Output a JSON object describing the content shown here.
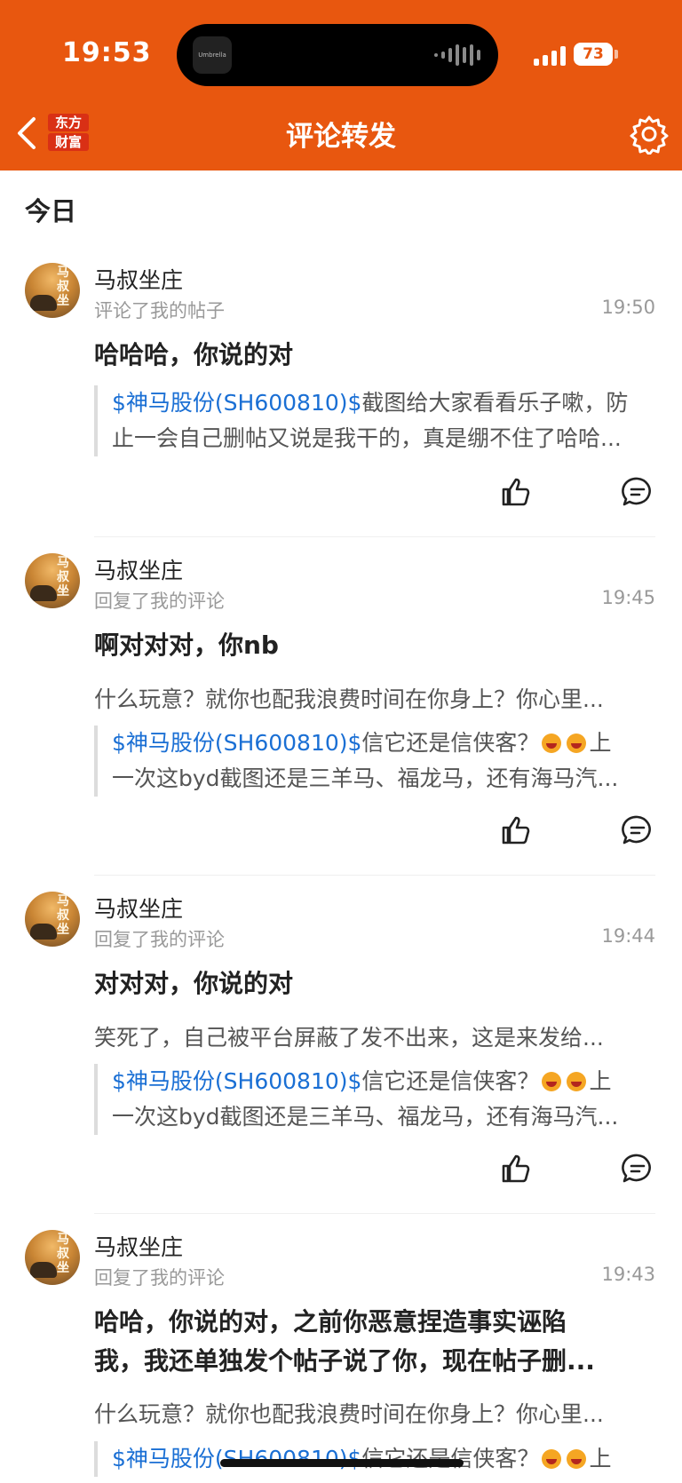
{
  "status_bar": {
    "time": "19:53",
    "battery": "73",
    "island_app": "Umbrella"
  },
  "nav": {
    "brand_line1": "东方",
    "brand_line2": "财富",
    "title": "评论转发"
  },
  "section_label": "今日",
  "items": [
    {
      "username": "马叔坐庄",
      "action": "评论了我的帖子",
      "time": "19:50",
      "comment_l1": "哈哈哈，你说的对",
      "comment_l2": "",
      "reply": "",
      "quote_stock": "$神马股份(SH600810)$",
      "quote_l1": "截图给大家看看乐子嗽，防",
      "quote_l2": "止一会自己删帖又说是我干的，真是绷不住了哈哈..."
    },
    {
      "username": "马叔坐庄",
      "action": "回复了我的评论",
      "time": "19:45",
      "comment_l1": "啊对对对，你nb",
      "comment_l2": "",
      "reply": "什么玩意？就你也配我浪费时间在你身上？你心里...",
      "quote_stock": "$神马股份(SH600810)$",
      "quote_l1": "信它还是信侠客？",
      "quote_l1_tail": "上",
      "quote_l2": "一次这byd截图还是三羊马、福龙马，还有海马汽..."
    },
    {
      "username": "马叔坐庄",
      "action": "回复了我的评论",
      "time": "19:44",
      "comment_l1": "对对对，你说的对",
      "comment_l2": "",
      "reply": "笑死了，自己被平台屏蔽了发不出来，这是来发给...",
      "quote_stock": "$神马股份(SH600810)$",
      "quote_l1": "信它还是信侠客？",
      "quote_l1_tail": "上",
      "quote_l2": "一次这byd截图还是三羊马、福龙马，还有海马汽..."
    },
    {
      "username": "马叔坐庄",
      "action": "回复了我的评论",
      "time": "19:43",
      "comment_l1": "哈哈，你说的对，之前你恶意捏造事实诬陷",
      "comment_l2": "我，我还单独发个帖子说了你，现在帖子删...",
      "reply": "什么玩意？就你也配我浪费时间在你身上？你心里...",
      "quote_stock": "$神马股份(SH600810)$",
      "quote_l1": "信它还是信侠客？",
      "quote_l1_tail": "上",
      "quote_l2": ""
    }
  ],
  "colors": {
    "brand": "#e8570f",
    "link": "#1a6fd4",
    "meta": "#999999"
  },
  "icons": [
    "back-icon",
    "settings-gear-icon",
    "thumbs-up-icon",
    "comment-bubble-icon"
  ]
}
